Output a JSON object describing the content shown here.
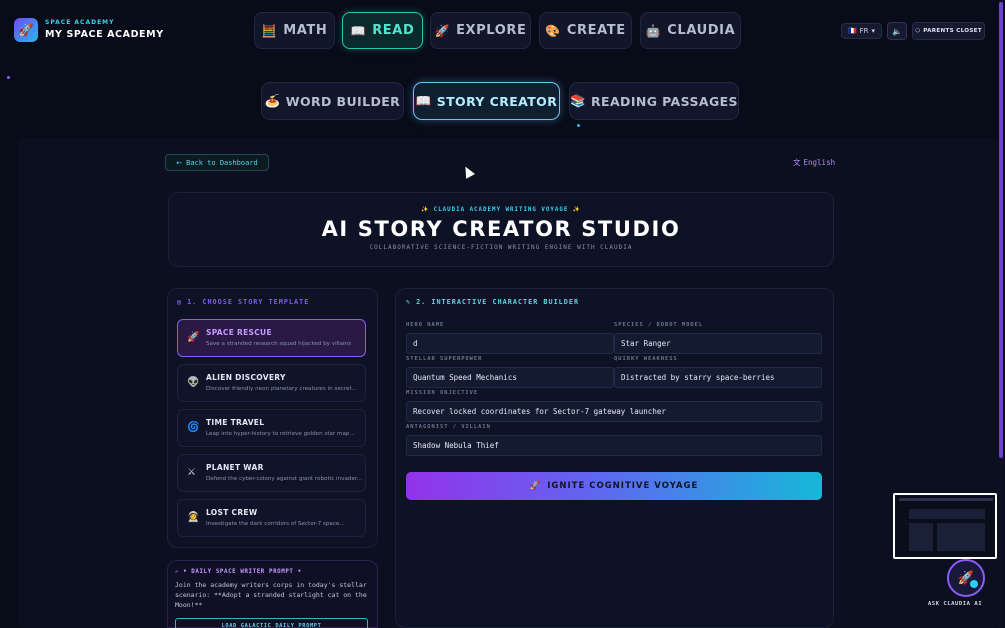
{
  "brand": {
    "sub": "SPACE ACADEMY",
    "title": "MY SPACE ACADEMY",
    "icon": "rocket-icon"
  },
  "nav": [
    {
      "label": "MATH",
      "icon": "🧮"
    },
    {
      "label": "READ",
      "icon": "📖"
    },
    {
      "label": "EXPLORE",
      "icon": "🚀"
    },
    {
      "label": "CREATE",
      "icon": "🎨"
    },
    {
      "label": "CLAUDIA",
      "icon": "🤖"
    }
  ],
  "header_right": {
    "language": "FR",
    "flag": "🇫🇷",
    "parents": "PARENTS CLOSET"
  },
  "subtabs": [
    {
      "label": "WORD BUILDER",
      "icon": "🍝"
    },
    {
      "label": "STORY CREATOR",
      "icon": "📖"
    },
    {
      "label": "READING PASSAGES",
      "icon": "📚"
    }
  ],
  "back_label": "Back to Dashboard",
  "language_label": "English",
  "hero": {
    "kicker": "✨ CLAUDIA ACADEMY WRITING VOYAGE ✨",
    "title": "AI STORY CREATOR STUDIO",
    "subtitle": "COLLABORATIVE SCIENCE-FICTION WRITING ENGINE WITH CLAUDIA"
  },
  "templates": {
    "title": "1. CHOOSE STORY TEMPLATE",
    "items": [
      {
        "icon": "🚀",
        "title": "SPACE RESCUE",
        "desc": "Save a stranded research squad hijacked by villains"
      },
      {
        "icon": "👽",
        "title": "ALIEN DISCOVERY",
        "desc": "Discover friendly neon planetary creatures in secret..."
      },
      {
        "icon": "🌀",
        "title": "TIME TRAVEL",
        "desc": "Leap into hyper-history to retrieve golden star map..."
      },
      {
        "icon": "⚔",
        "title": "PLANET WAR",
        "desc": "Defend the cyber-colony against giant robotic invader..."
      },
      {
        "icon": "👩‍🚀",
        "title": "LOST CREW",
        "desc": "Investigate the dark corridors of Sector-7 space..."
      }
    ]
  },
  "builder": {
    "title": "2. INTERACTIVE CHARACTER BUILDER",
    "hero_name_label": "HERO NAME",
    "hero_name_value": "d",
    "species_label": "SPECIES / ROBOT MODEL",
    "species_value": "Star Ranger",
    "superpower_label": "STELLAR SUPERPOWER",
    "superpower_value": "Quantum Speed Mechanics",
    "weakness_label": "QUIRKY WEAKNESS",
    "weakness_value": "Distracted by starry space-berries",
    "objective_label": "MISSION OBJECTIVE",
    "objective_value": "Recover locked coordinates for Sector-7 gateway launcher",
    "villain_label": "ANTAGONIST / VILLAIN",
    "villain_value": "Shadow Nebula Thief",
    "button": "IGNITE COGNITIVE VOYAGE"
  },
  "daily": {
    "title": "• DAILY SPACE WRITER PROMPT •",
    "text": "Join the academy writers corps in today's stellar scenario: **Adopt a stranded starlight cat on the Moon!**",
    "button": "LOAD GALACTIC DAILY PROMPT"
  },
  "claudia": {
    "label": "ASK CLAUDIA AI"
  }
}
